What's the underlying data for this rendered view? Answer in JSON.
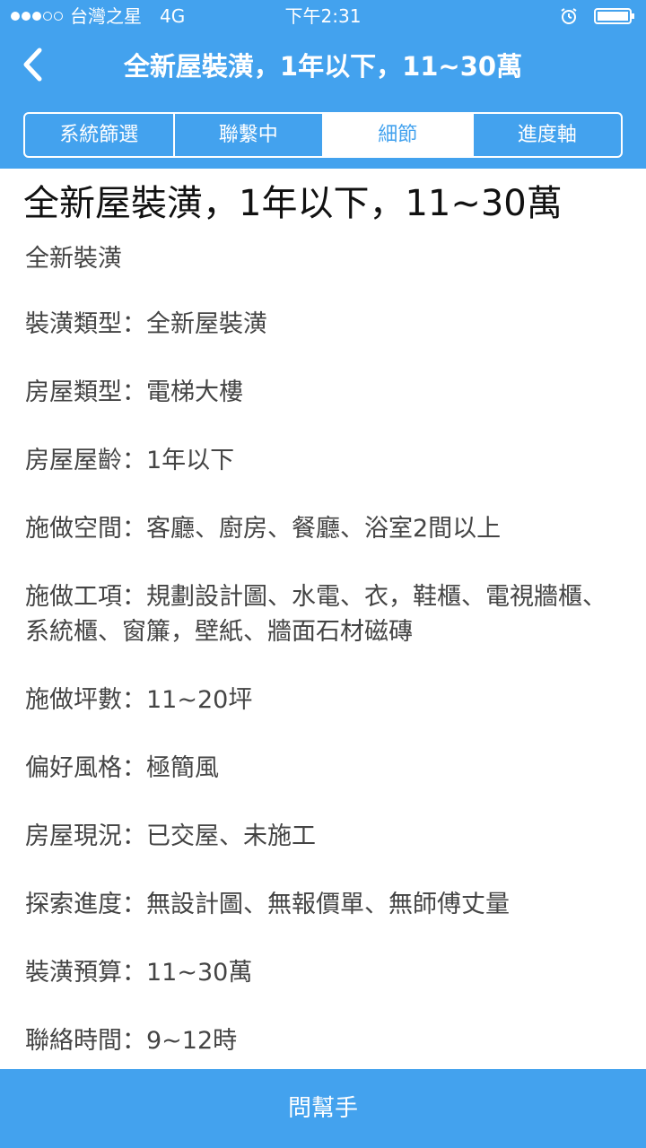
{
  "status_bar": {
    "carrier": "台灣之星",
    "network": "4G",
    "time": "下午2:31",
    "signal_bars_filled": 3,
    "signal_bars_total": 5,
    "icons": [
      "signal-dots-icon",
      "alarm-icon",
      "battery-icon"
    ]
  },
  "nav": {
    "title": "全新屋裝潢，1年以下，11~30萬",
    "back_icon": "chevron-left-icon"
  },
  "tabs": [
    {
      "label": "系統篩選",
      "active": false
    },
    {
      "label": "聯繫中",
      "active": false
    },
    {
      "label": "細節",
      "active": true
    },
    {
      "label": "進度軸",
      "active": false
    }
  ],
  "detail": {
    "title": "全新屋裝潢，1年以下，11~30萬",
    "subtitle": "全新裝潢",
    "items": [
      "裝潢類型：全新屋裝潢",
      "房屋類型：電梯大樓",
      "房屋屋齡：1年以下",
      "施做空間：客廳、廚房、餐廳、浴室2間以上",
      "施做工項：規劃設計圖、水電、衣，鞋櫃、電視牆櫃、系統櫃、窗簾，壁紙、牆面石材磁磚",
      "施做坪數：11~20坪",
      "偏好風格：極簡風",
      "房屋現況：已交屋、未施工",
      "探索進度：無設計圖、無報價單、無師傅丈量",
      "裝潢預算：11~30萬",
      "聯絡時間：9~12時"
    ]
  },
  "bottom_button": {
    "label": "問幫手"
  },
  "colors": {
    "primary": "#43a2ee",
    "text_dark": "#111111",
    "text_body": "#444444",
    "background": "#ffffff"
  }
}
